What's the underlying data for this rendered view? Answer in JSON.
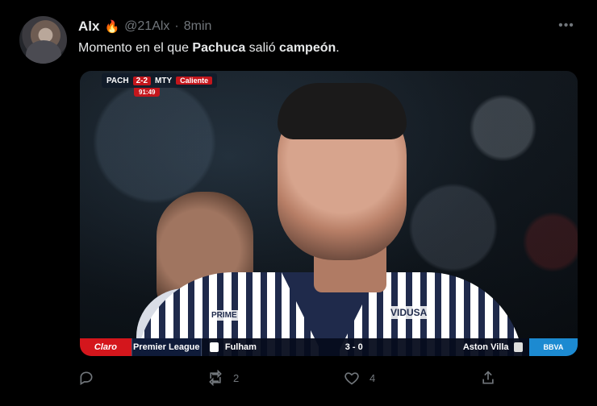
{
  "tweet": {
    "display_name": "Alx",
    "emoji": "🔥",
    "handle": "@21Alx",
    "separator": "·",
    "time": "8min",
    "more_label": "•••",
    "text_parts": {
      "t1": "Momento en el que ",
      "b1": "Pachuca",
      "t2": " salió ",
      "b2": "campeón",
      "t3": "."
    }
  },
  "media": {
    "scorebug": {
      "home": "PACH",
      "score": "2-2",
      "away": "MTY",
      "sponsor": "Caliente",
      "clock": "91:49"
    },
    "ticker": {
      "brand": "Claro",
      "league": "Premier League",
      "home_team": "Fulham",
      "score": "3 - 0",
      "away_team": "Aston Villa",
      "right_brand": "BBVA"
    },
    "jersey": {
      "sponsor_left": "PRIME",
      "sponsor_right": "VIDUSA"
    }
  },
  "actions": {
    "reply_count": "",
    "retweet_count": "2",
    "like_count": "4",
    "share_count": ""
  }
}
